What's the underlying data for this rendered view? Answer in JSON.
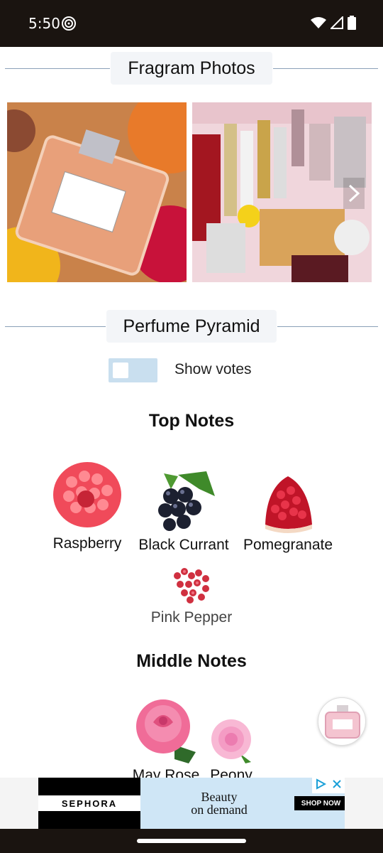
{
  "status_bar": {
    "time": "5:50"
  },
  "photos_section": {
    "title": "Fragram Photos"
  },
  "pyramid_section": {
    "title": "Perfume Pyramid"
  },
  "votes_toggle": {
    "label": "Show votes"
  },
  "top_notes": {
    "title": "Top Notes",
    "items": [
      "Raspberry",
      "Black Currant",
      "Pomegranate",
      "Pink Pepper"
    ]
  },
  "middle_notes": {
    "title": "Middle Notes",
    "items": [
      "May Rose",
      "Peony"
    ]
  },
  "ad": {
    "brand": "SEPHORA",
    "line1": "Beauty",
    "line2": "on demand",
    "cta": "SHOP NOW"
  },
  "colors": {
    "status_bar": "#1a1410",
    "toggle_track": "#c9dfef",
    "ad_background": "#cfe6f6"
  }
}
